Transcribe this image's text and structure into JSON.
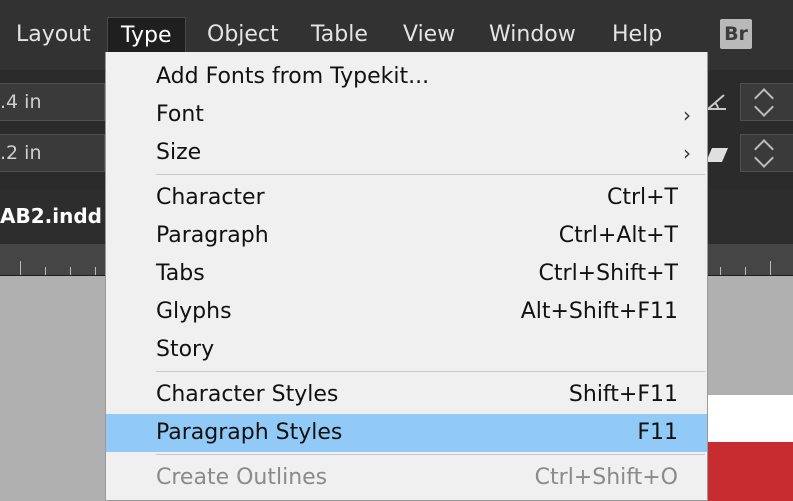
{
  "menubar": {
    "items": [
      {
        "label": "Layout"
      },
      {
        "label": "Type"
      },
      {
        "label": "Object"
      },
      {
        "label": "Table"
      },
      {
        "label": "View"
      },
      {
        "label": "Window"
      },
      {
        "label": "Help"
      }
    ],
    "bridge_badge": "Br"
  },
  "control_panel": {
    "field1_value": ".4 in",
    "field2_value": ".2 in"
  },
  "document": {
    "tab_title": "AB2.indd @"
  },
  "type_menu": {
    "items": [
      {
        "label": "Add Fonts from Typekit...",
        "shortcut": ""
      },
      {
        "label": "Font",
        "submenu_arrow": "›"
      },
      {
        "label": "Size",
        "submenu_arrow": "›"
      },
      {
        "label": "Character",
        "shortcut": "Ctrl+T"
      },
      {
        "label": "Paragraph",
        "shortcut": "Ctrl+Alt+T"
      },
      {
        "label": "Tabs",
        "shortcut": "Ctrl+Shift+T"
      },
      {
        "label": "Glyphs",
        "shortcut": "Alt+Shift+F11"
      },
      {
        "label": "Story",
        "shortcut": ""
      },
      {
        "label": "Character Styles",
        "shortcut": "Shift+F11"
      },
      {
        "label": "Paragraph Styles",
        "shortcut": "F11"
      },
      {
        "label": "Create Outlines",
        "shortcut": "Ctrl+Shift+O"
      }
    ]
  },
  "colors": {
    "highlight": "#91c9f7",
    "menubar_bg": "#323232",
    "menu_bg": "#f0f0f0",
    "page_accent": "#c72c30"
  }
}
